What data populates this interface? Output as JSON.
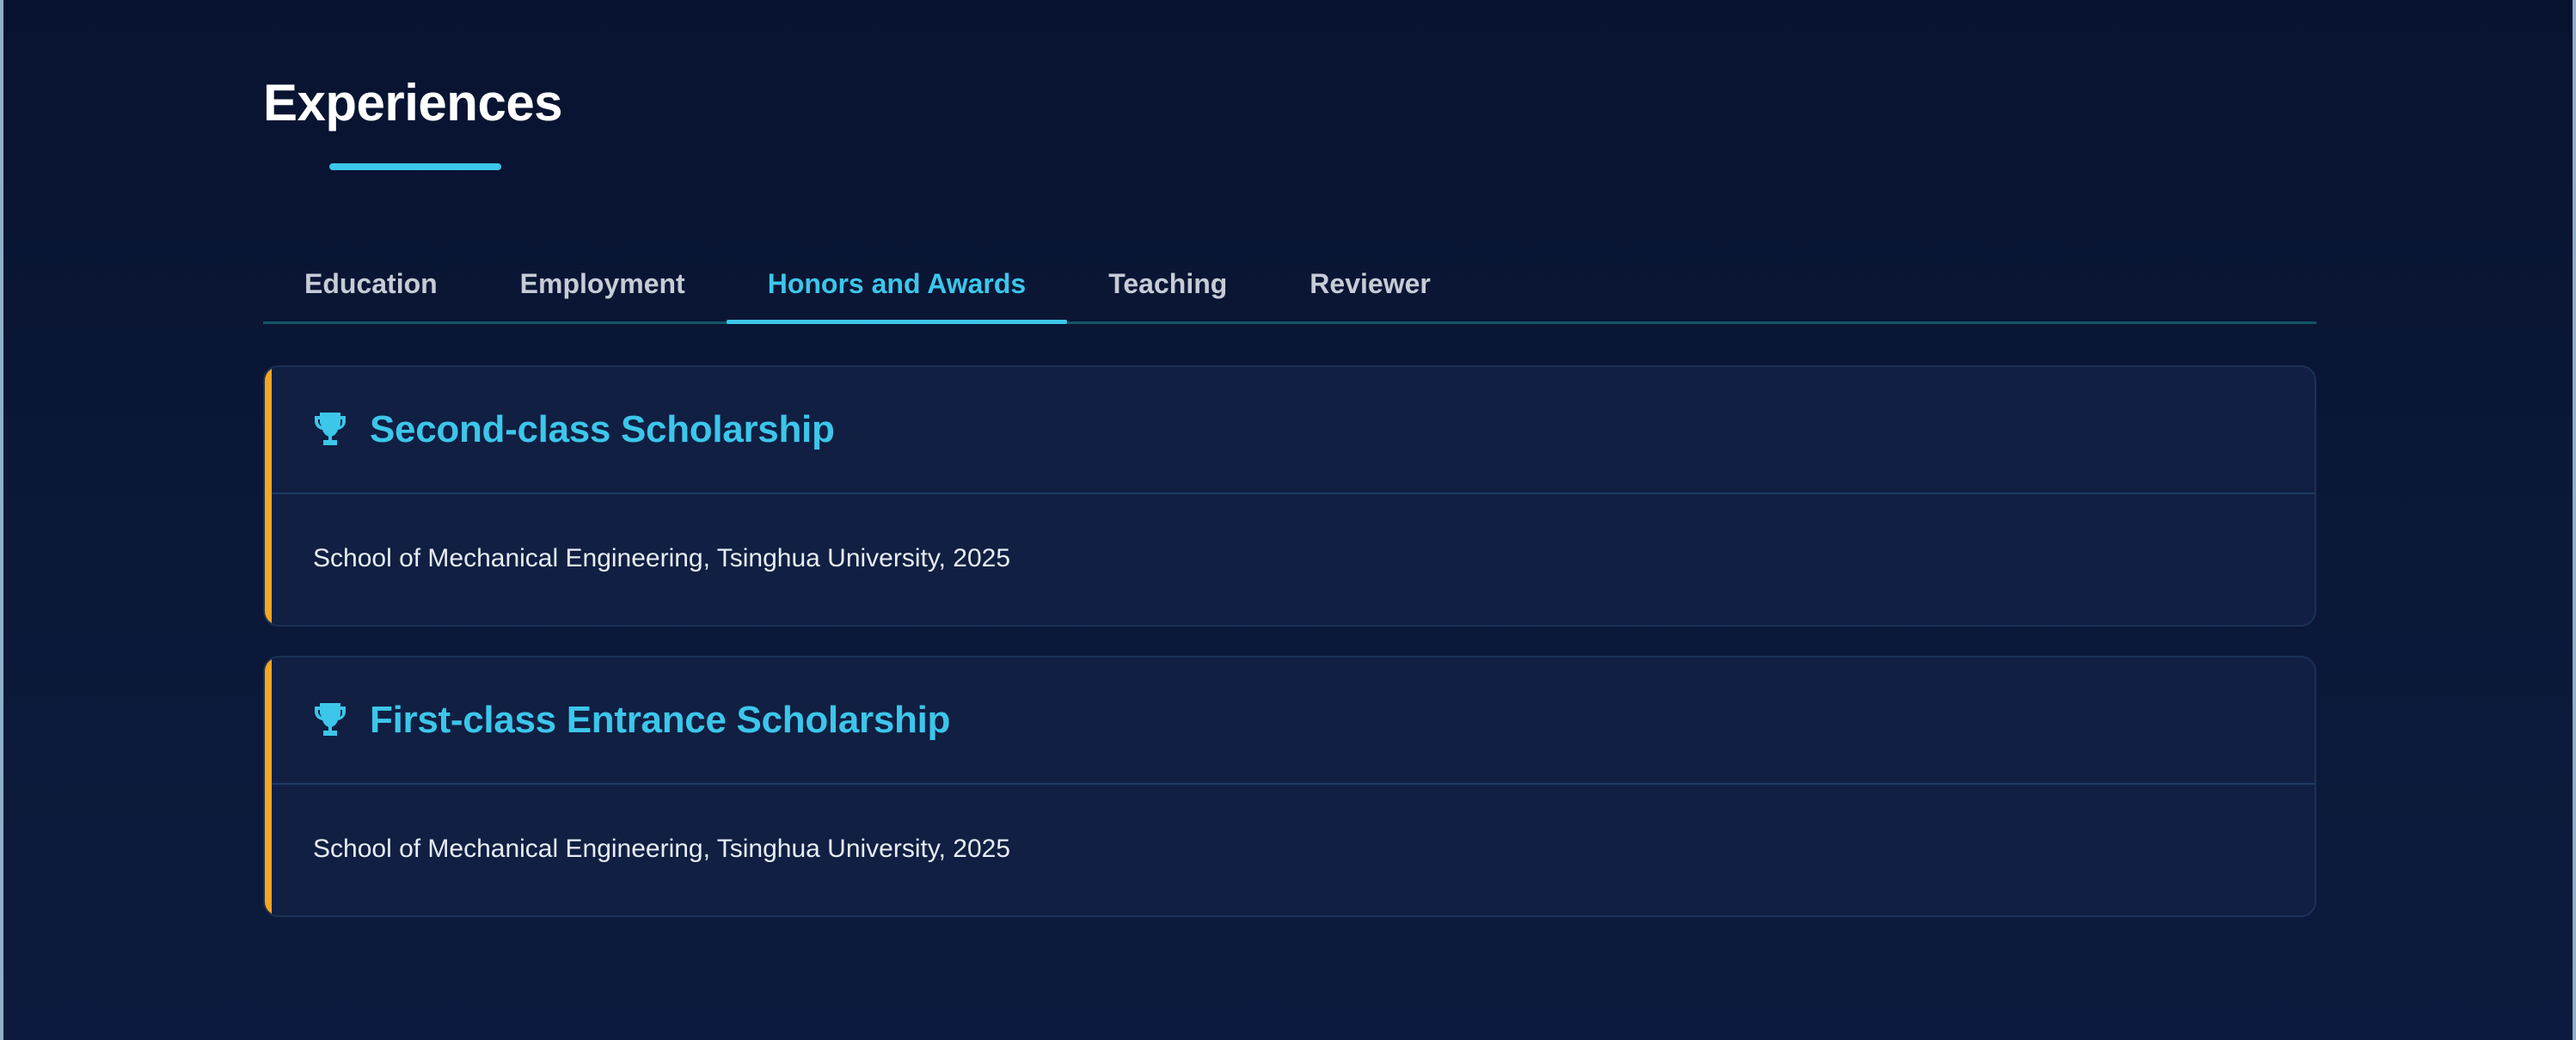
{
  "section": {
    "title": "Experiences"
  },
  "tabs": [
    {
      "label": "Education",
      "active": false
    },
    {
      "label": "Employment",
      "active": false
    },
    {
      "label": "Honors and Awards",
      "active": true
    },
    {
      "label": "Teaching",
      "active": false
    },
    {
      "label": "Reviewer",
      "active": false
    }
  ],
  "awards": [
    {
      "icon": "trophy-icon",
      "title": "Second-class Scholarship",
      "detail": "School of Mechanical Engineering, Tsinghua University, 2025"
    },
    {
      "icon": "trophy-icon",
      "title": "First-class Entrance Scholarship",
      "detail": "School of Mechanical Engineering, Tsinghua University, 2025"
    }
  ],
  "colors": {
    "accent": "#3cc6ea",
    "card_stripe": "#f5a623",
    "background": "#0b1838"
  }
}
